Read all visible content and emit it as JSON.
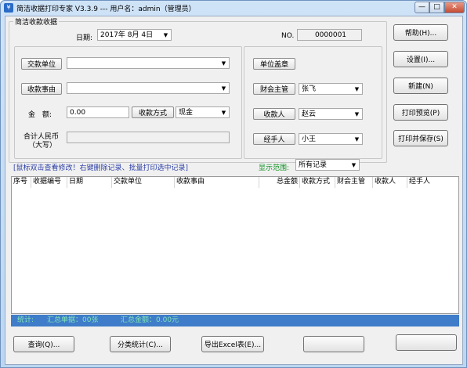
{
  "window": {
    "title": "简洁收据打印专家 V3.3.9 --- 用户名：admin（管理员）",
    "app_icon": "receipt-app-icon",
    "min": "—",
    "max": "□",
    "close": "✕"
  },
  "form": {
    "group_title": "简洁收款收据",
    "date_label": "日期:",
    "date_value": "2017年 8月 4日",
    "no_label": "NO.",
    "no_value": "0000001",
    "payer_button": "交款单位",
    "payer_value": "",
    "reason_button": "收款事由",
    "reason_value": "",
    "amount_label": "金　额:",
    "amount_value": "0.00",
    "method_button": "收款方式",
    "method_value": "现金",
    "total_label_1": "合计人民币",
    "total_label_2": "（大写）",
    "total_value": "",
    "seal_button": "单位盖章",
    "finance_button": "财会主管",
    "finance_value": "张飞",
    "payee_button": "收款人",
    "payee_value": "赵云",
    "handler_button": "经手人",
    "handler_value": "小王"
  },
  "side_buttons": {
    "help": "帮助(H)...",
    "settings": "设置(I)...",
    "new": "新建(N)",
    "print_preview": "打印预览(P)",
    "print_save": "打印并保存(S)"
  },
  "hint": "[鼠标双击查看修改！右键删除记录、批量打印选中记录]",
  "range": {
    "label": "显示范围:",
    "value": "所有记录"
  },
  "table": {
    "columns": [
      "序号",
      "收据编号",
      "日期",
      "交款单位",
      "收款事由",
      "总金额",
      "收款方式",
      "财会主管",
      "收款人",
      "经手人"
    ],
    "rows": []
  },
  "status": {
    "stats_label": "统计:",
    "count_text": "汇总单据：00张",
    "sum_text": "汇总金额：0.00元"
  },
  "bottom_buttons": {
    "query": "查询(Q)...",
    "category": "分类统计(C)...",
    "export": "导出Excel表(E)...",
    "btn4": "",
    "btn5": ""
  },
  "colors": {
    "hint": "#2b3ea6",
    "range_label": "#0b8f1f",
    "status_bar": "#3f7cc9",
    "status_text": "#7fe7b5"
  }
}
